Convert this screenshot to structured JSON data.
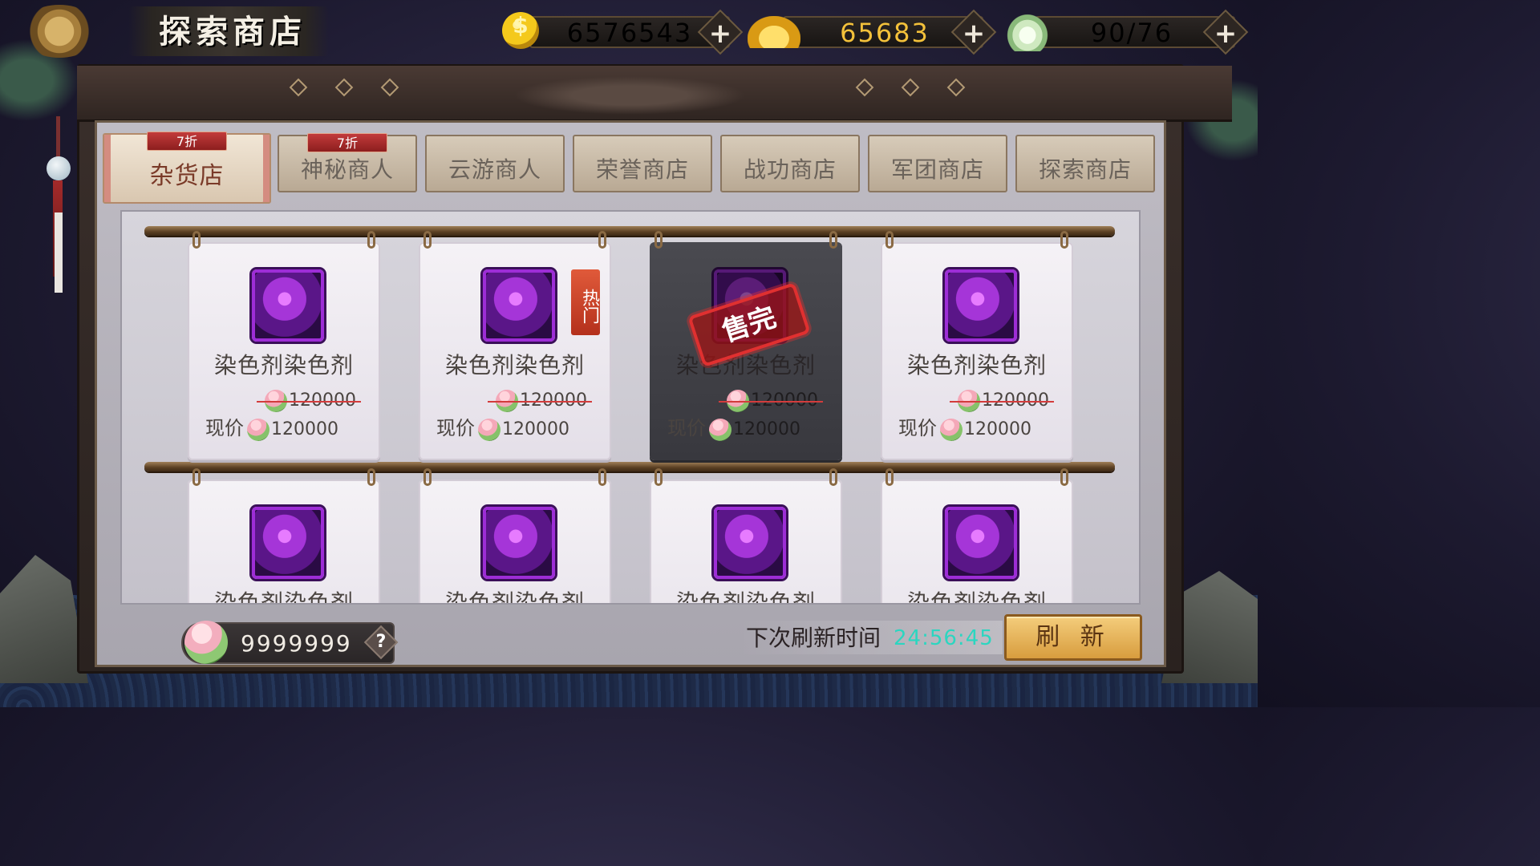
{
  "title": "探索商店",
  "currencies": [
    {
      "name": "gold",
      "value": "6576543",
      "color": "#f1ece4"
    },
    {
      "name": "ingot",
      "value": "65683",
      "color": "#f3c13a"
    },
    {
      "name": "lotus",
      "value": "90/76",
      "color": "#f1ece4"
    }
  ],
  "plus_symbol": "+",
  "tabs": [
    {
      "label": "杂货店",
      "discount": "7折",
      "active": true
    },
    {
      "label": "神秘商人",
      "discount": "7折",
      "active": false
    },
    {
      "label": "云游商人",
      "discount": "",
      "active": false
    },
    {
      "label": "荣誉商店",
      "discount": "",
      "active": false
    },
    {
      "label": "战功商店",
      "discount": "",
      "active": false
    },
    {
      "label": "军团商店",
      "discount": "",
      "active": false
    },
    {
      "label": "探索商店",
      "discount": "",
      "active": false
    }
  ],
  "items": [
    {
      "name": "染色剂染色剂",
      "old_price": "120000",
      "price_label": "现价",
      "price": "120000",
      "hot": false,
      "sold_out": false
    },
    {
      "name": "染色剂染色剂",
      "old_price": "120000",
      "price_label": "现价",
      "price": "120000",
      "hot": true,
      "hot_label": "热门",
      "sold_out": false
    },
    {
      "name": "染色剂染色剂",
      "old_price": "120000",
      "price_label": "现价",
      "price": "120000",
      "hot": false,
      "sold_out": true,
      "sold_label": "售完"
    },
    {
      "name": "染色剂染色剂",
      "old_price": "120000",
      "price_label": "现价",
      "price": "120000",
      "hot": false,
      "sold_out": false
    },
    {
      "name": "染色剂染色剂",
      "hot": false,
      "sold_out": false
    },
    {
      "name": "染色剂染色剂",
      "hot": false,
      "sold_out": false
    },
    {
      "name": "染色剂染色剂",
      "hot": false,
      "sold_out": false
    },
    {
      "name": "染色剂染色剂",
      "hot": false,
      "sold_out": false
    }
  ],
  "balance": {
    "value": "9999999",
    "help": "?"
  },
  "refresh": {
    "label": "下次刷新时间",
    "time": "24:56:45",
    "button": "刷 新"
  }
}
